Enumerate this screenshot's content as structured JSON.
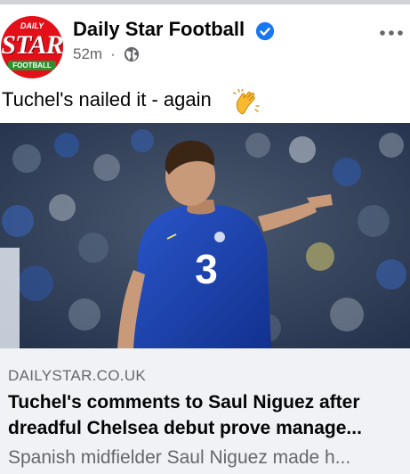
{
  "post": {
    "page_name": "Daily Star Football",
    "time_ago": "52m",
    "separator": "·",
    "caption": "Tuchel's nailed it - again",
    "caption_emoji": "clapping-hands-icon",
    "more_icon": "more-options-icon",
    "privacy_icon": "globe-icon",
    "verified_icon": "verified-badge-icon"
  },
  "avatar": {
    "top_text": "DAILY",
    "main_text": "STAR",
    "band_text": "FOOTBALL"
  },
  "link_preview": {
    "domain": "DAILYSTAR.CO.UK",
    "headline_line1": "Tuchel's comments to Saul Niguez after",
    "headline_line2": "dreadful Chelsea debut prove manage...",
    "description": "Spanish midfielder Saul Niguez made h..."
  },
  "colors": {
    "brand_red": "#e3101a",
    "verified_blue": "#1877f2",
    "secondary_text": "#65676b",
    "link_bg": "#f0f2f5",
    "chelsea_blue": "#1a3fa8"
  }
}
